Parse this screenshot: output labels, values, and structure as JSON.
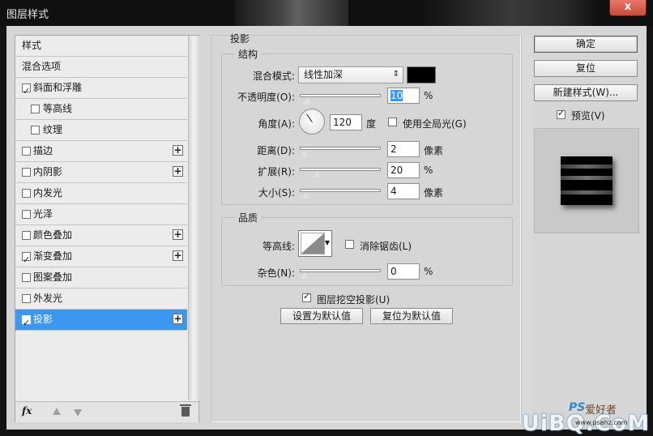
{
  "window": {
    "title": "图层样式",
    "close_label": "x"
  },
  "style_list": {
    "items": [
      {
        "label": "样式",
        "checkbox": false,
        "checked": false,
        "plus": false,
        "indent": false,
        "selected": false
      },
      {
        "label": "混合选项",
        "checkbox": false,
        "checked": false,
        "plus": false,
        "indent": false,
        "selected": false
      },
      {
        "label": "斜面和浮雕",
        "checkbox": true,
        "checked": true,
        "plus": false,
        "indent": false,
        "selected": false
      },
      {
        "label": "等高线",
        "checkbox": true,
        "checked": false,
        "plus": false,
        "indent": true,
        "selected": false
      },
      {
        "label": "纹理",
        "checkbox": true,
        "checked": false,
        "plus": false,
        "indent": true,
        "selected": false
      },
      {
        "label": "描边",
        "checkbox": true,
        "checked": false,
        "plus": true,
        "indent": false,
        "selected": false
      },
      {
        "label": "内阴影",
        "checkbox": true,
        "checked": false,
        "plus": true,
        "indent": false,
        "selected": false
      },
      {
        "label": "内发光",
        "checkbox": true,
        "checked": false,
        "plus": false,
        "indent": false,
        "selected": false
      },
      {
        "label": "光泽",
        "checkbox": true,
        "checked": false,
        "plus": false,
        "indent": false,
        "selected": false
      },
      {
        "label": "颜色叠加",
        "checkbox": true,
        "checked": false,
        "plus": true,
        "indent": false,
        "selected": false
      },
      {
        "label": "渐变叠加",
        "checkbox": true,
        "checked": true,
        "plus": true,
        "indent": false,
        "selected": false
      },
      {
        "label": "图案叠加",
        "checkbox": true,
        "checked": false,
        "plus": false,
        "indent": false,
        "selected": false
      },
      {
        "label": "外发光",
        "checkbox": true,
        "checked": false,
        "plus": false,
        "indent": false,
        "selected": false
      },
      {
        "label": "投影",
        "checkbox": true,
        "checked": true,
        "plus": true,
        "indent": false,
        "selected": true
      }
    ],
    "footer": {
      "fx_label": "fx",
      "fx_icon": "fx-icon",
      "up_icon": "arrow-up-icon",
      "down_icon": "arrow-down-icon",
      "trash_icon": "trash-icon"
    }
  },
  "drop_shadow": {
    "section_title": "投影",
    "structure": {
      "title": "结构",
      "blend_mode_label": "混合模式:",
      "blend_mode_value": "线性加深",
      "blend_color": "#000000",
      "opacity_label": "不透明度(O):",
      "opacity_value": "10",
      "opacity_unit": "%",
      "opacity_level": 0.1,
      "angle_label": "角度(A):",
      "angle_value": "120",
      "angle_unit": "度",
      "global_light_label": "使用全局光(G)",
      "global_light_checked": false,
      "distance_label": "距离(D):",
      "distance_value": "2",
      "distance_unit": "像素",
      "spread_label": "扩展(R):",
      "spread_value": "20",
      "spread_unit": "%",
      "size_label": "大小(S):",
      "size_value": "4",
      "size_unit": "像素"
    },
    "quality": {
      "title": "品质",
      "contour_label": "等高线:",
      "anti_alias_label": "消除锯齿(L)",
      "anti_alias_checked": false,
      "noise_label": "杂色(N):",
      "noise_value": "0",
      "noise_unit": "%"
    },
    "knockout_label": "图层挖空投影(U)",
    "knockout_checked": true,
    "make_default_label": "设置为默认值",
    "reset_default_label": "复位为默认值"
  },
  "actions": {
    "ok_label": "确定",
    "reset_label": "复位",
    "new_style_label": "新建样式(W)...",
    "preview_label": "预览(V)",
    "preview_checked": true
  },
  "watermark": {
    "ps": "PS",
    "sub": "爱好者",
    "main": "UiBQ.CoM",
    "url": "www.psahz.com"
  }
}
